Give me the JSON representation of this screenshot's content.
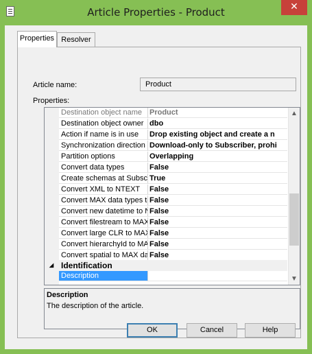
{
  "window": {
    "title": "Article Properties - Product",
    "close_symbol": "✕",
    "icon": "document-icon"
  },
  "tabs": [
    {
      "label": "Properties",
      "active": true
    },
    {
      "label": "Resolver",
      "active": false
    }
  ],
  "article_name": {
    "label": "Article name:",
    "value": "Product"
  },
  "properties_label": "Properties:",
  "grid": {
    "rows": [
      {
        "name": "Destination object name",
        "value": "Product",
        "disabled": true
      },
      {
        "name": "Destination object owner",
        "value": "dbo"
      },
      {
        "name": "Action if name is in use",
        "value": "Drop existing object and create a n"
      },
      {
        "name": "Synchronization direction",
        "value": "Download-only to Subscriber, prohi"
      },
      {
        "name": "Partition options",
        "value": "Overlapping"
      },
      {
        "name": "Convert data types",
        "value": "False"
      },
      {
        "name": "Create schemas at Subscri",
        "value": "True"
      },
      {
        "name": "Convert XML to NTEXT",
        "value": "False"
      },
      {
        "name": "Convert MAX data types to",
        "value": "False"
      },
      {
        "name": "Convert new datetime to N",
        "value": "False"
      },
      {
        "name": "Convert filestream to MAX",
        "value": "False"
      },
      {
        "name": "Convert large CLR to MAX",
        "value": "False"
      },
      {
        "name": "Convert hierarchyId to MA",
        "value": "False"
      },
      {
        "name": "Convert spatial to MAX dat",
        "value": "False"
      }
    ],
    "category": {
      "toggle_symbol": "◢",
      "label": "Identification"
    },
    "selected_row": {
      "name": "Description",
      "value": ""
    },
    "scroll_up_symbol": "▲",
    "scroll_down_symbol": "▼"
  },
  "description_pane": {
    "title": "Description",
    "text": "The description of the article."
  },
  "buttons": {
    "ok": "OK",
    "cancel": "Cancel",
    "help": "Help"
  }
}
